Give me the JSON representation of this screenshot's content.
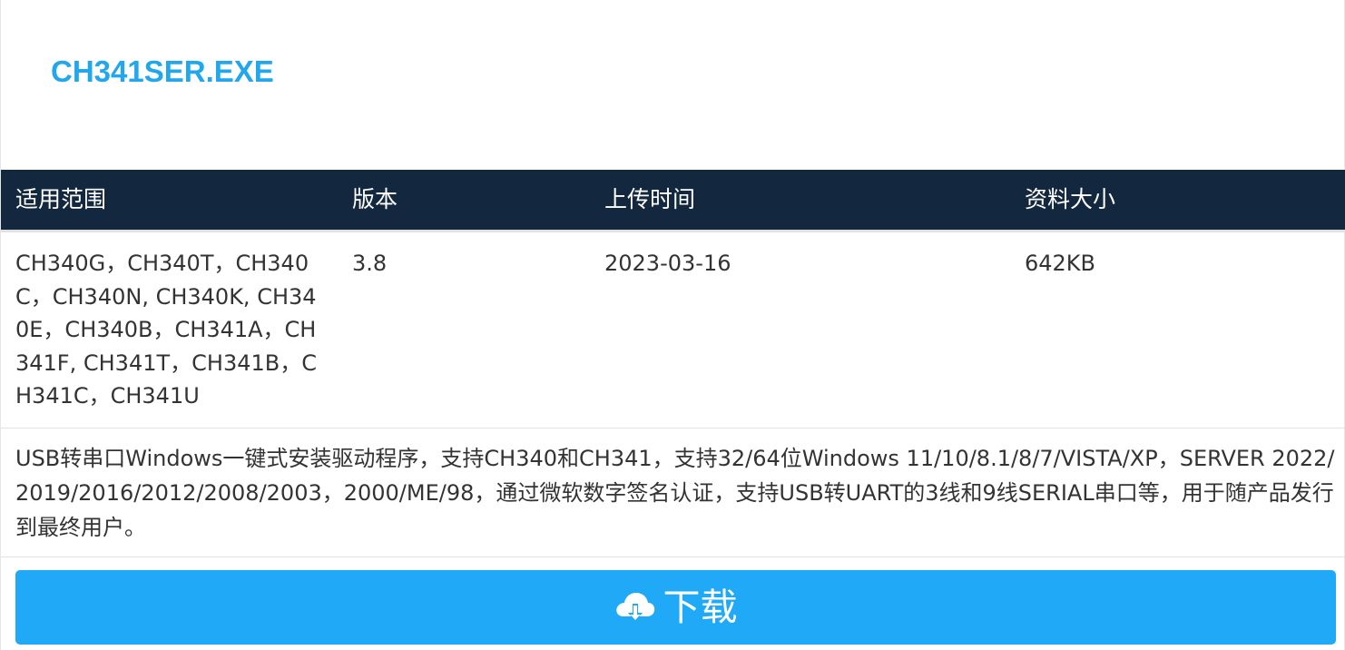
{
  "file": {
    "title": "CH341SER.EXE"
  },
  "table": {
    "headers": {
      "scope": "适用范围",
      "version": "版本",
      "upload_time": "上传时间",
      "size": "资料大小"
    },
    "row": {
      "scope": "CH340G，CH340T，CH340C，CH340N, CH340K, CH340E，CH340B，CH341A，CH341F, CH341T，CH341B，CH341C，CH341U",
      "version": "3.8",
      "upload_time": "2023-03-16",
      "size": "642KB"
    }
  },
  "description": "USB转串口Windows一键式安装驱动程序，支持CH340和CH341，支持32/64位Windows 11/10/8.1/8/7/VISTA/XP，SERVER 2022/2019/2016/2012/2008/2003，2000/ME/98，通过微软数字签名认证，支持USB转UART的3线和9线SERIAL串口等，用于随产品发行到最终用户。",
  "download": {
    "label": "下载",
    "icon": "cloud-download-icon"
  },
  "colors": {
    "title": "#22a6ec",
    "header_bg": "#13283f",
    "button_bg": "#1fa9f6"
  }
}
